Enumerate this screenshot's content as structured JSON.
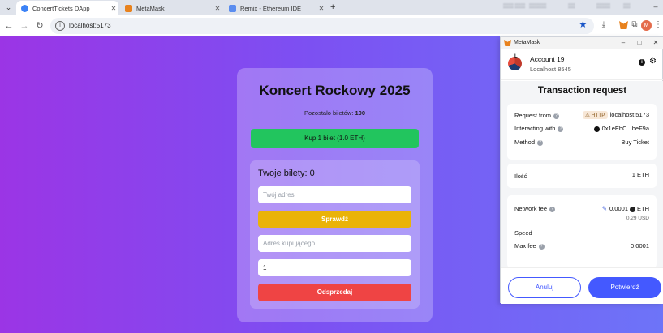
{
  "browser": {
    "tabs": [
      {
        "label": "ConcertTickets DApp",
        "color": "#3b82f6"
      },
      {
        "label": "MetaMask",
        "color": "#e8821e"
      },
      {
        "label": "Remix - Ethereum IDE",
        "color": "#5b8def"
      }
    ],
    "url": "localhost:5173",
    "profile_initial": "M"
  },
  "app": {
    "title": "Koncert Rockowy 2025",
    "remaining_label": "Pozostało biletów:",
    "remaining_count": "100",
    "buy_button": "Kup 1 bilet (1.0 ETH)",
    "tickets_heading": "Twoje bilety: 0",
    "address_placeholder": "Twój adres",
    "check_button": "Sprawdź",
    "buyer_placeholder": "Adres kupującego",
    "quantity_value": "1",
    "resell_button": "Odsprzedaj",
    "colors": {
      "buy": "#22c55e",
      "check": "#eab308",
      "resell": "#ef4444"
    }
  },
  "metamask": {
    "window_title": "MetaMask",
    "account_name": "Account 19",
    "network": "Localhost 8545",
    "heading": "Transaction request",
    "request_from_label": "Request from",
    "request_badge": "HTTP",
    "request_from_value": "localhost:5173",
    "interacting_label": "Interacting with",
    "interacting_value": "0x1eEbC...beF9a",
    "method_label": "Method",
    "method_value": "Buy Ticket",
    "amount_label": "Ilość",
    "amount_value": "1 ETH",
    "network_fee_label": "Network fee",
    "network_fee_value": "0.0001",
    "network_fee_unit": "ETH",
    "network_fee_usd": "0.29 USD",
    "speed_label": "Speed",
    "max_fee_label": "Max fee",
    "max_fee_value": "0.0001",
    "cancel_button": "Anuluj",
    "confirm_button": "Potwierdź",
    "accent": "#4459ff"
  }
}
